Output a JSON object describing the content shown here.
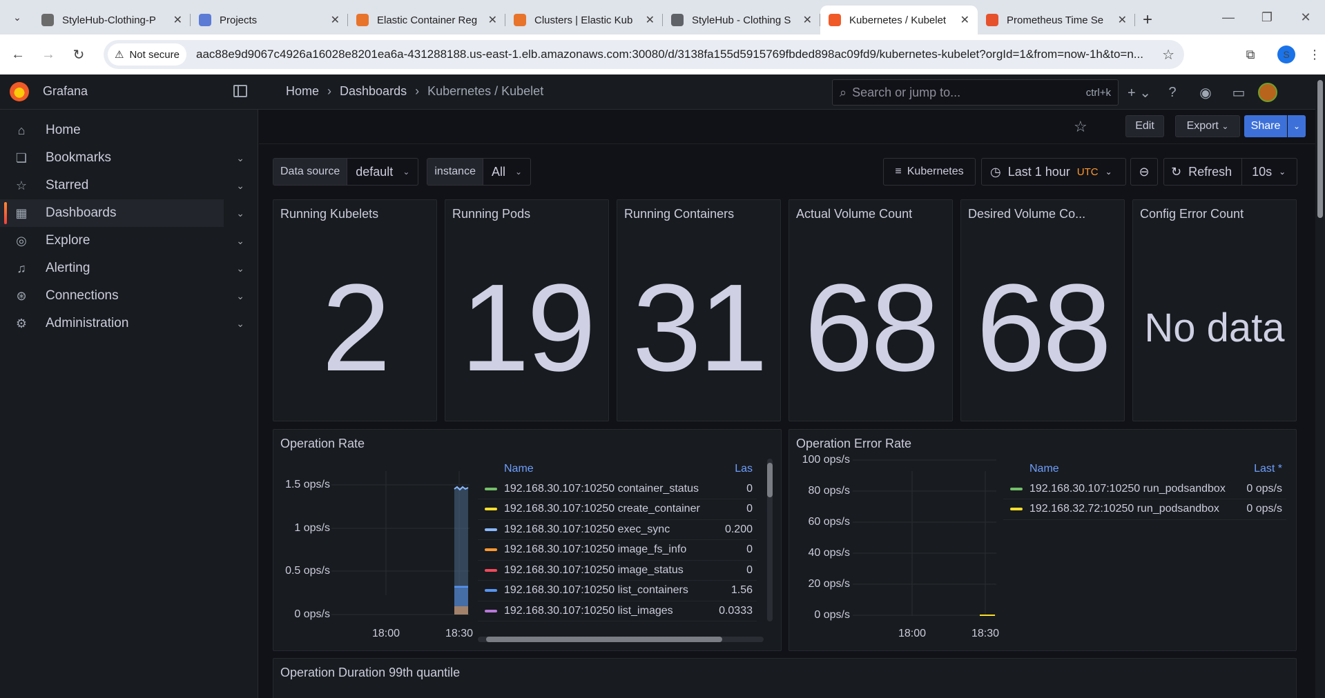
{
  "browser": {
    "tabs": [
      {
        "title": "StyleHub-Clothing-P",
        "color": "#6b6b6b"
      },
      {
        "title": "Projects",
        "color": "#5b7bd5"
      },
      {
        "title": "Elastic Container Reg",
        "color": "#e8742b"
      },
      {
        "title": "Clusters | Elastic Kub",
        "color": "#e8742b"
      },
      {
        "title": "StyleHub - Clothing S",
        "color": "#5f6368"
      },
      {
        "title": "Kubernetes / Kubelet",
        "color": "#f05a28"
      },
      {
        "title": "Prometheus Time Se",
        "color": "#e6522c"
      }
    ],
    "security_label": "Not secure",
    "url": "aac88e9d9067c4926a16028e8201ea6a-431288188.us-east-1.elb.amazonaws.com:30080/d/3138fa155d5915769fbded898ac09fd9/kubernetes-kubelet?orgId=1&from=now-1h&to=n...",
    "profile_initial": "S"
  },
  "grafana": {
    "brand": "Grafana",
    "breadcrumbs": [
      "Home",
      "Dashboards",
      "Kubernetes / Kubelet"
    ],
    "search_placeholder": "Search or jump to...",
    "search_shortcut": "ctrl+k",
    "nav": [
      {
        "label": "Home",
        "icon": "⌂",
        "chev": false
      },
      {
        "label": "Bookmarks",
        "icon": "❏",
        "chev": true
      },
      {
        "label": "Starred",
        "icon": "☆",
        "chev": true
      },
      {
        "label": "Dashboards",
        "icon": "▦",
        "chev": true
      },
      {
        "label": "Explore",
        "icon": "◎",
        "chev": true
      },
      {
        "label": "Alerting",
        "icon": "♫",
        "chev": true
      },
      {
        "label": "Connections",
        "icon": "⊛",
        "chev": true
      },
      {
        "label": "Administration",
        "icon": "⚙",
        "chev": true
      }
    ],
    "actions": {
      "edit": "Edit",
      "export": "Export",
      "share": "Share"
    },
    "vars": {
      "datasource_label": "Data source",
      "datasource_value": "default",
      "instance_label": "instance",
      "instance_value": "All"
    },
    "controls": {
      "kubernetes": "Kubernetes",
      "time_range": "Last 1 hour",
      "timezone": "UTC",
      "refresh": "Refresh",
      "interval": "10s"
    },
    "stats": [
      {
        "title": "Running Kubelets",
        "value": "2"
      },
      {
        "title": "Running Pods",
        "value": "19"
      },
      {
        "title": "Running Containers",
        "value": "31"
      },
      {
        "title": "Actual Volume Count",
        "value": "68"
      },
      {
        "title": "Desired Volume Co...",
        "value": "68"
      },
      {
        "title": "Config Error Count",
        "value": "No data"
      }
    ],
    "operation_rate": {
      "title": "Operation Rate",
      "y_ticks": [
        "1.5 ops/s",
        "1 ops/s",
        "0.5 ops/s",
        "0 ops/s"
      ],
      "x_ticks": [
        "18:00",
        "18:30"
      ],
      "legend_header": {
        "name": "Name",
        "value": "Las"
      },
      "legend": [
        {
          "name": "192.168.30.107:10250 container_status",
          "value": "0",
          "color": "#73bf69"
        },
        {
          "name": "192.168.30.107:10250 create_container",
          "value": "0",
          "color": "#fade2a"
        },
        {
          "name": "192.168.30.107:10250 exec_sync",
          "value": "0.200",
          "color": "#8ab8ff"
        },
        {
          "name": "192.168.30.107:10250 image_fs_info",
          "value": "0",
          "color": "#ff9830"
        },
        {
          "name": "192.168.30.107:10250 image_status",
          "value": "0",
          "color": "#f2495c"
        },
        {
          "name": "192.168.30.107:10250 list_containers",
          "value": "1.56",
          "color": "#5794f2"
        },
        {
          "name": "192.168.30.107:10250 list_images",
          "value": "0.0333",
          "color": "#b877d9"
        }
      ]
    },
    "operation_error_rate": {
      "title": "Operation Error Rate",
      "y_ticks": [
        "100 ops/s",
        "80 ops/s",
        "60 ops/s",
        "40 ops/s",
        "20 ops/s",
        "0 ops/s"
      ],
      "x_ticks": [
        "18:00",
        "18:30"
      ],
      "legend_header": {
        "name": "Name",
        "value": "Last *"
      },
      "legend": [
        {
          "name": "192.168.30.107:10250 run_podsandbox",
          "value": "0 ops/s",
          "color": "#73bf69"
        },
        {
          "name": "192.168.32.72:10250 run_podsandbox",
          "value": "0 ops/s",
          "color": "#fade2a"
        }
      ]
    },
    "duration_panel_title": "Operation Duration 99th quantile"
  }
}
